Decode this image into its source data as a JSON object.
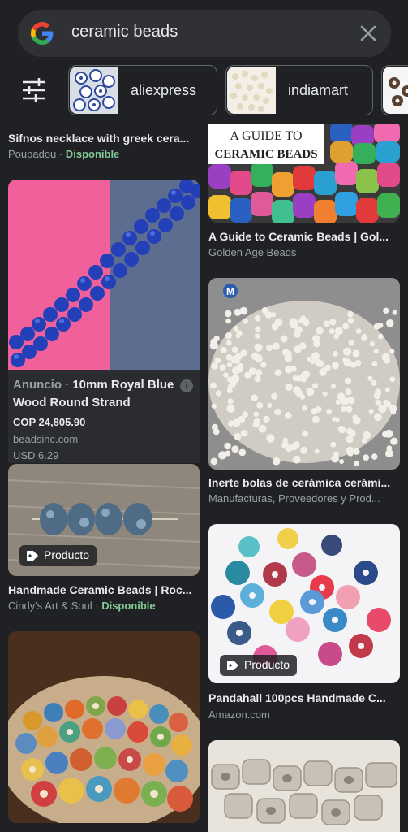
{
  "search": {
    "query": "ceramic beads"
  },
  "chips": [
    {
      "label": "aliexpress"
    },
    {
      "label": "indiamart"
    }
  ],
  "left_column": [
    {
      "title": "Sifnos necklace with greek cera...",
      "source": "Poupadou",
      "availability": "Disponible"
    },
    {
      "ad_label": "Anuncio",
      "title_line1": "10mm Royal Blue",
      "title_line2": "Wood Round Strand",
      "price": "COP 24,805.90",
      "site": "beadsinc.com",
      "alt_price": "USD 6.29",
      "info": "i"
    },
    {
      "badge": "Producto",
      "title": "Handmade Ceramic Beads | Roc...",
      "source": "Cindy's Art & Soul",
      "availability": "Disponible"
    }
  ],
  "right_column": [
    {
      "image_text_line1": "A GUIDE TO",
      "image_text_line2": "CERAMIC BEADS",
      "title": "A Guide to Ceramic Beads | Gol...",
      "source": "Golden Age Beads"
    },
    {
      "title": "Inerte bolas de cerámica cerámi...",
      "source": "Manufacturas, Proveedores y Prod...",
      "logo_letter": "M"
    },
    {
      "badge": "Producto",
      "title": "Pandahall 100pcs Handmade C...",
      "source": "Amazon.com"
    }
  ],
  "colors": {
    "background": "#202124",
    "search_bar": "#303134",
    "text": "#e8eaed",
    "secondary_text": "#9aa0a6",
    "available": "#81c995"
  },
  "icons": [
    "google-logo-icon",
    "clear-icon",
    "filter-sliders-icon",
    "tag-icon",
    "info-icon"
  ]
}
